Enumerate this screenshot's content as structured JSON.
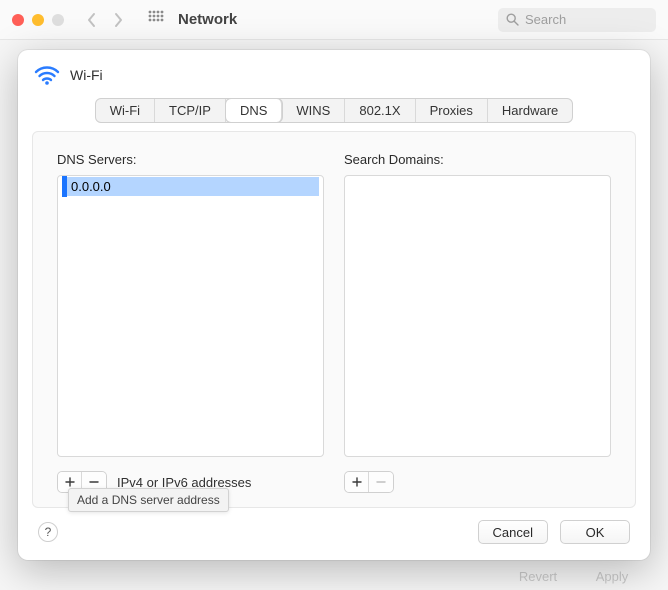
{
  "toolbar": {
    "title": "Network",
    "search_placeholder": "Search"
  },
  "sheet": {
    "title": "Wi-Fi",
    "tabs": [
      "Wi-Fi",
      "TCP/IP",
      "DNS",
      "WINS",
      "802.1X",
      "Proxies",
      "Hardware"
    ],
    "active_tab_index": 2,
    "dns": {
      "label": "DNS Servers:",
      "entries": [
        "0.0.0.0"
      ],
      "editing_index": 0,
      "hint": "IPv4 or IPv6 addresses",
      "tooltip": "Add a DNS server address"
    },
    "search_domains": {
      "label": "Search Domains:",
      "entries": []
    },
    "buttons": {
      "cancel": "Cancel",
      "ok": "OK",
      "help": "?"
    }
  },
  "behind": {
    "revert": "Revert",
    "apply": "Apply"
  }
}
